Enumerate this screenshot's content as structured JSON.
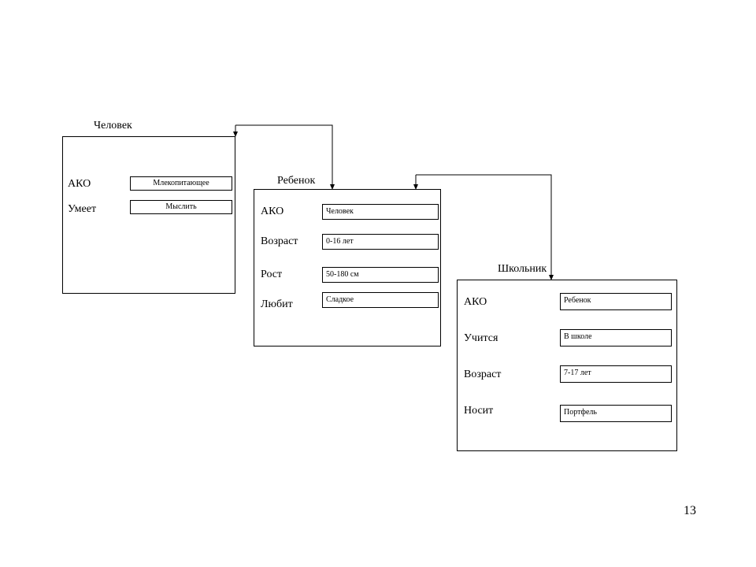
{
  "page_number": "13",
  "frames": {
    "human": {
      "title": "Человек",
      "rows": [
        {
          "label": "АКО",
          "value": "Млекопитающее"
        },
        {
          "label": "Умеет",
          "value": "Мыслить"
        }
      ]
    },
    "child": {
      "title": "Ребенок",
      "rows": [
        {
          "label": "АКО",
          "value": "Человек"
        },
        {
          "label": "Возраст",
          "value": "0-16 лет"
        },
        {
          "label": "Рост",
          "value": "50-180 см"
        },
        {
          "label": "Любит",
          "value": "Сладкое"
        }
      ]
    },
    "pupil": {
      "title": "Школьник",
      "rows": [
        {
          "label": "АКО",
          "value": "Ребенок"
        },
        {
          "label": "Учится",
          "value": "В школе"
        },
        {
          "label": "Возраст",
          "value": "7-17 лет"
        },
        {
          "label": "Носит",
          "value": "Портфель"
        }
      ]
    }
  }
}
